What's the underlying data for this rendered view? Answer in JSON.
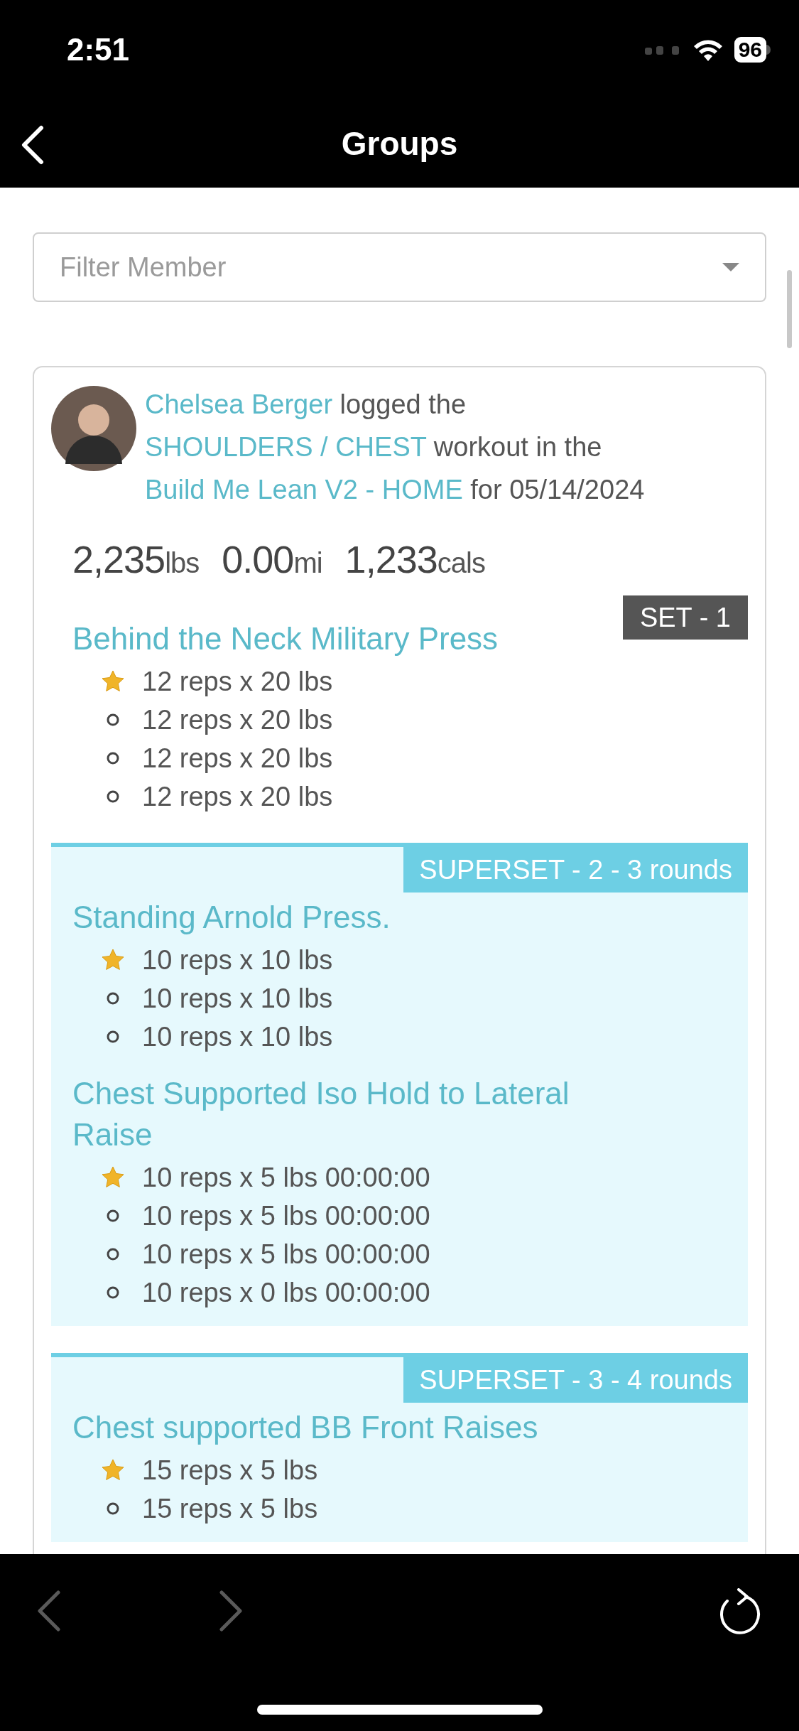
{
  "status_bar": {
    "time": "2:51",
    "battery": "96"
  },
  "nav": {
    "title": "Groups"
  },
  "filter": {
    "placeholder": "Filter Member"
  },
  "card": {
    "header": [
      {
        "kind": "link",
        "text": "Chelsea Berger"
      },
      {
        "kind": "text",
        "text": " logged the "
      },
      {
        "kind": "link",
        "text": "SHOULDERS / CHEST"
      },
      {
        "kind": "text",
        "text": " workout in the "
      },
      {
        "kind": "link",
        "text": "Build Me Lean V2 - HOME"
      },
      {
        "kind": "text",
        "text": " for 05/14/2024"
      }
    ],
    "stats": [
      {
        "value": "2,235",
        "unit": "lbs"
      },
      {
        "value": "0.00",
        "unit": "mi"
      },
      {
        "value": "1,233",
        "unit": "cals"
      }
    ],
    "sections": [
      {
        "kind": "set",
        "badge": "SET - 1",
        "exercises": [
          {
            "title": "Behind the Neck Military Press",
            "sets": [
              {
                "text": "12 reps x 20 lbs",
                "starred": true
              },
              {
                "text": "12 reps x 20 lbs",
                "starred": false
              },
              {
                "text": "12 reps x 20 lbs",
                "starred": false
              },
              {
                "text": "12 reps x 20 lbs",
                "starred": false
              }
            ]
          }
        ]
      },
      {
        "kind": "superset",
        "badge": "SUPERSET - 2 - 3 rounds",
        "exercises": [
          {
            "title": "Standing Arnold Press.",
            "sets": [
              {
                "text": "10 reps x 10 lbs",
                "starred": true
              },
              {
                "text": "10 reps x 10 lbs",
                "starred": false
              },
              {
                "text": "10 reps x 10 lbs",
                "starred": false
              }
            ]
          },
          {
            "title": "Chest Supported Iso Hold to Lateral Raise",
            "sets": [
              {
                "text": "10 reps x 5 lbs 00:00:00",
                "starred": true
              },
              {
                "text": "10 reps x 5 lbs 00:00:00",
                "starred": false
              },
              {
                "text": "10 reps x 5 lbs 00:00:00",
                "starred": false
              },
              {
                "text": "10 reps x 0 lbs 00:00:00",
                "starred": false
              }
            ]
          }
        ]
      },
      {
        "kind": "superset",
        "badge": "SUPERSET - 3 - 4 rounds",
        "exercises": [
          {
            "title": "Chest supported BB Front Raises",
            "sets": [
              {
                "text": "15 reps x 5 lbs",
                "starred": true
              },
              {
                "text": "15 reps x 5 lbs",
                "starred": false
              }
            ]
          }
        ]
      }
    ]
  },
  "browser_bar": {
    "back": {
      "disabled": true
    },
    "forward": {
      "disabled": true
    }
  }
}
